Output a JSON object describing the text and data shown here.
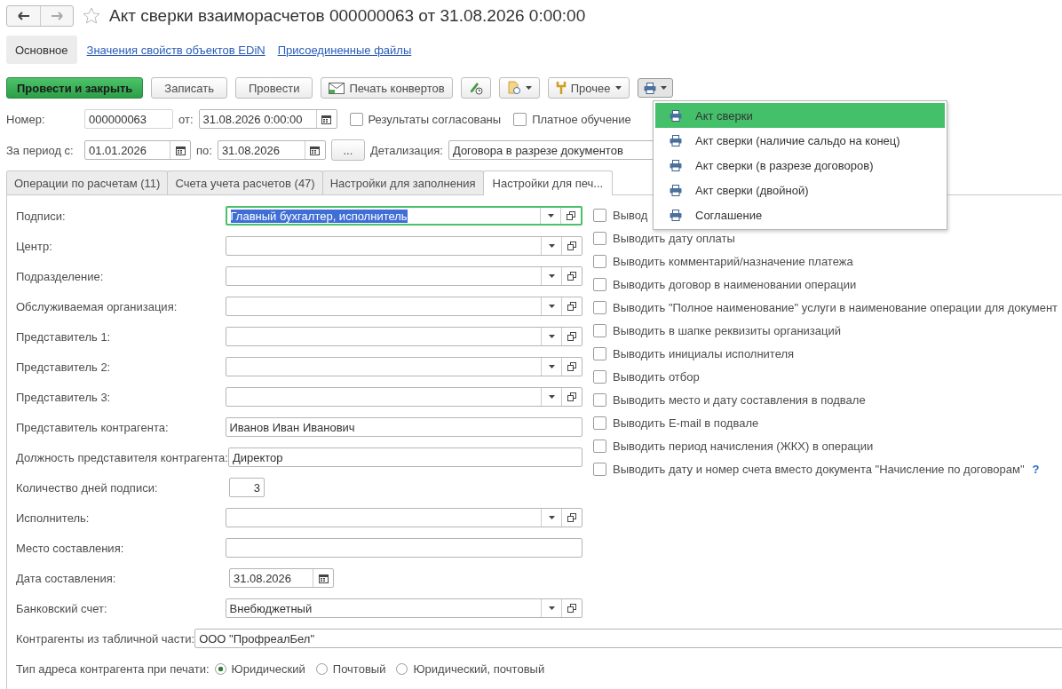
{
  "window": {
    "title": "Акт сверки взаиморасчетов 000000063 от 31.08.2026 0:00:00"
  },
  "sections": [
    {
      "label": "Основное",
      "selected": true
    },
    {
      "label": "Значения свойств объектов EDiN",
      "selected": false
    },
    {
      "label": "Присоединенные файлы",
      "selected": false
    }
  ],
  "toolbar": [
    {
      "kind": "primary",
      "label": "Провести и закрыть"
    },
    {
      "kind": "plain",
      "label": "Записать"
    },
    {
      "kind": "plain",
      "label": "Провести"
    },
    {
      "kind": "envelope",
      "label": "Печать конвертов"
    },
    {
      "kind": "sign"
    },
    {
      "kind": "attach"
    },
    {
      "kind": "more",
      "label": "Прочее"
    },
    {
      "kind": "print"
    }
  ],
  "header": {
    "number": {
      "label": "Номер:",
      "value": "000000063"
    },
    "date": {
      "label": "от:",
      "value": "31.08.2026  0:00:00"
    },
    "checkboxes": [
      {
        "label": "Результаты согласованы",
        "checked": false
      },
      {
        "label": "Платное обучение",
        "checked": false
      }
    ],
    "period": {
      "label": "За период с:",
      "from": "01.01.2026",
      "to_label": "по:",
      "to": "31.08.2026",
      "button": "..."
    },
    "detail": {
      "label": "Детализация:",
      "value": "Договора в разрезе документов"
    }
  },
  "tabs": [
    {
      "label": "Операции по расчетам (11)",
      "selected": false
    },
    {
      "label": "Счета учета расчетов (47)",
      "selected": false
    },
    {
      "label": "Настройки для заполнения",
      "selected": false
    },
    {
      "label": "Настройки для печ...",
      "selected": true
    }
  ],
  "fields": [
    {
      "label": "Подписи:",
      "kind": "combo",
      "value": "Главный бухгалтер, исполнитель",
      "focused": true
    },
    {
      "label": "Центр:",
      "kind": "combo"
    },
    {
      "label": "Подразделение:",
      "kind": "combo"
    },
    {
      "label": "Обслуживаемая организация:",
      "kind": "combo"
    },
    {
      "label": "Представитель 1:",
      "kind": "combo"
    },
    {
      "label": "Представитель 2:",
      "kind": "combo"
    },
    {
      "label": "Представитель 3:",
      "kind": "combo"
    },
    {
      "label": "Представитель контрагента:",
      "kind": "text",
      "value": "Иванов Иван Иванович"
    },
    {
      "label": "Должность представителя контрагента:",
      "kind": "text",
      "value": "Директор"
    },
    {
      "label": "Количество дней подписи:",
      "kind": "number",
      "value": "3"
    },
    {
      "label": "Исполнитель:",
      "kind": "combo"
    },
    {
      "label": "Место составления:",
      "kind": "text"
    },
    {
      "label": "Дата составления:",
      "kind": "date",
      "value": "31.08.2026"
    },
    {
      "label": "Банковский счет:",
      "kind": "combo",
      "value": "Внебюджетный"
    }
  ],
  "options": [
    {
      "label": "Вывод",
      "checked": false
    },
    {
      "label": "Выводить дату оплаты",
      "checked": false
    },
    {
      "label": "Выводить комментарий/назначение платежа",
      "checked": false
    },
    {
      "label": "Выводить договор в наименовании операции",
      "checked": false
    },
    {
      "label": "Выводить \"Полное наименование\" услуги в наименование операции для документ",
      "checked": false
    },
    {
      "label": "Выводить в шапке реквизиты организаций",
      "checked": false
    },
    {
      "label": "Выводить инициалы исполнителя",
      "checked": false
    },
    {
      "label": "Выводить отбор",
      "checked": false
    },
    {
      "label": "Выводить место и дату составления в подвале",
      "checked": false
    },
    {
      "label": "Выводить E-mail в подвале",
      "checked": false
    },
    {
      "label": "Выводить период начисления (ЖКХ) в операции",
      "checked": false
    },
    {
      "label": "Выводить дату и номер счета вместо документа \"Начисление по договорам\"",
      "checked": false,
      "help": "?"
    }
  ],
  "counterparties": {
    "label": "Контрагенты из табличной части:",
    "value": "ООО \"ПрофреалБел\""
  },
  "address_type": {
    "label": "Тип адреса контрагента при печати:",
    "options": [
      {
        "label": "Юридический",
        "selected": true
      },
      {
        "label": "Почтовый",
        "selected": false
      },
      {
        "label": "Юридический, почтовый",
        "selected": false
      }
    ]
  },
  "print_menu": {
    "items": [
      {
        "label": "Акт сверки",
        "selected": true
      },
      {
        "label": "Акт сверки (наличие сальдо на конец)",
        "selected": false
      },
      {
        "label": "Акт сверки (в разрезе договоров)",
        "selected": false
      },
      {
        "label": "Акт сверки (двойной)",
        "selected": false
      },
      {
        "label": "Соглашение",
        "selected": false
      }
    ]
  }
}
